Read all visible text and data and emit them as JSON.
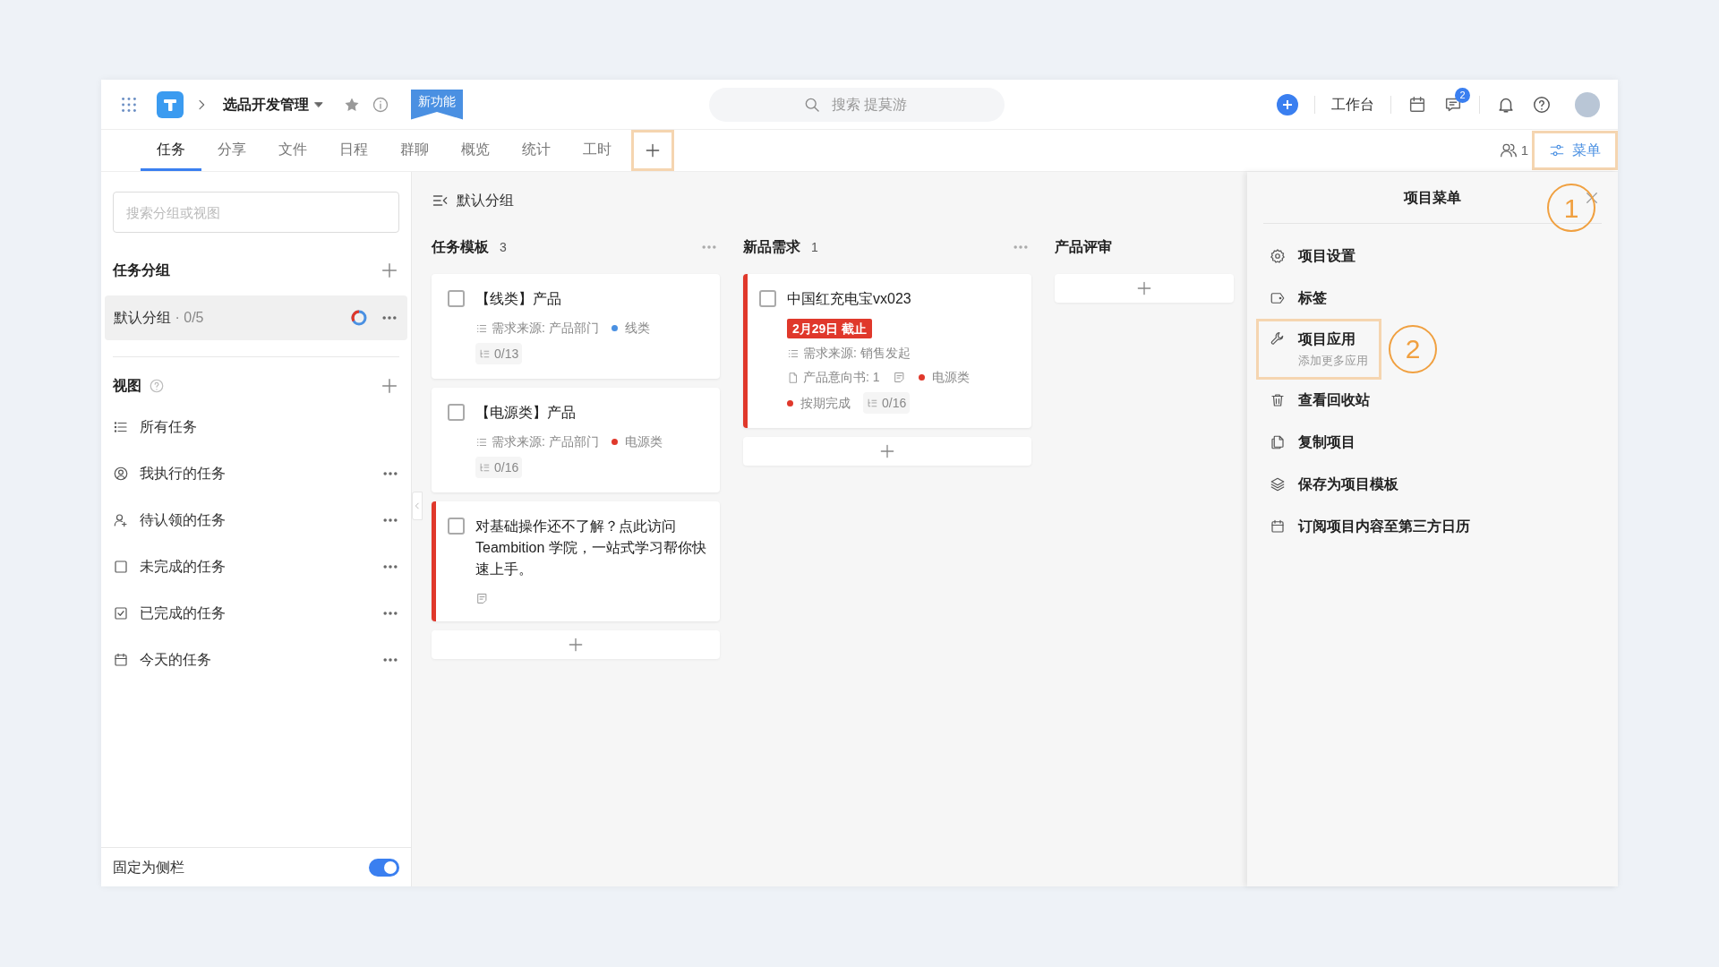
{
  "header": {
    "project": "选品开发管理",
    "new_feature_badge": "新功能",
    "search_placeholder": "搜索 提莫游",
    "workbench": "工作台",
    "message_count": "2"
  },
  "tabs": [
    {
      "label": "任务",
      "selected": true
    },
    {
      "label": "分享",
      "selected": false
    },
    {
      "label": "文件",
      "selected": false
    },
    {
      "label": "日程",
      "selected": false
    },
    {
      "label": "群聊",
      "selected": false
    },
    {
      "label": "概览",
      "selected": false
    },
    {
      "label": "统计",
      "selected": false
    },
    {
      "label": "工时",
      "selected": false
    }
  ],
  "add_tab": {
    "highlighted": true
  },
  "members_count": "1",
  "menu_button": {
    "label": "菜单",
    "highlighted": true
  },
  "sidebar": {
    "search_placeholder": "搜索分组或视图",
    "groups_title": "任务分组",
    "groups": [
      {
        "name": "默认分组",
        "count": "· 0/5",
        "selected": true
      }
    ],
    "views_title": "视图",
    "views": [
      {
        "kind": "list",
        "label": "所有任务",
        "has_more": false
      },
      {
        "kind": "user",
        "label": "我执行的任务",
        "has_more": true
      },
      {
        "kind": "user-plus",
        "label": "待认领的任务",
        "has_more": true
      },
      {
        "kind": "square",
        "label": "未完成的任务",
        "has_more": true
      },
      {
        "kind": "check-square",
        "label": "已完成的任务",
        "has_more": true
      },
      {
        "kind": "calendar",
        "label": "今天的任务",
        "has_more": true
      }
    ],
    "pin_label": "固定为侧栏",
    "pin_on": true
  },
  "board": {
    "group_title": "默认分组",
    "columns": [
      {
        "title": "任务模板",
        "count": "3",
        "has_more": true,
        "cards": [
          {
            "title": "【线类】产品",
            "checked": false,
            "priority_mark": false,
            "rows": [
              [
                {
                  "kind": "source",
                  "text": "需求来源: 产品部门"
                },
                {
                  "kind": "tag",
                  "text": "线类",
                  "color": "#4a90e2"
                }
              ],
              [
                {
                  "kind": "subtasks",
                  "text": "0/13"
                }
              ]
            ]
          },
          {
            "title": "【电源类】产品",
            "checked": false,
            "priority_mark": false,
            "rows": [
              [
                {
                  "kind": "source",
                  "text": "需求来源: 产品部门"
                },
                {
                  "kind": "tag",
                  "text": "电源类",
                  "color": "#e0382b"
                }
              ],
              [
                {
                  "kind": "subtasks",
                  "text": "0/16"
                }
              ]
            ]
          },
          {
            "title": "对基础操作还不了解？点此访问 Teambition 学院，一站式学习帮你快速上手。",
            "checked": false,
            "priority_mark": true,
            "rows": [
              [
                {
                  "kind": "note"
                }
              ]
            ]
          }
        ]
      },
      {
        "title": "新品需求",
        "count": "1",
        "has_more": true,
        "cards": [
          {
            "title": "中国红充电宝vx023",
            "checked": false,
            "priority_mark": true,
            "deadline": "2月29日 截止",
            "rows": [
              [
                {
                  "kind": "source",
                  "text": "需求来源: 销售发起"
                }
              ],
              [
                {
                  "kind": "doc",
                  "text": "产品意向书: 1"
                },
                {
                  "kind": "note"
                },
                {
                  "kind": "tag",
                  "text": "电源类",
                  "color": "#e0382b"
                }
              ],
              [
                {
                  "kind": "tag",
                  "text": "按期完成",
                  "color": "#e0382b"
                },
                {
                  "kind": "subtasks",
                  "text": "0/16"
                }
              ]
            ]
          }
        ]
      },
      {
        "title": "产品评审",
        "has_more": false
      }
    ]
  },
  "menu_panel": {
    "title": "项目菜单",
    "callout": "1",
    "items": [
      {
        "kind": "gear",
        "label": "项目设置",
        "highlighted": false
      },
      {
        "kind": "tag",
        "label": "标签",
        "highlighted": false
      },
      {
        "kind": "wrench",
        "label": "项目应用",
        "subtitle": "添加更多应用",
        "highlighted": true,
        "callout": "2"
      },
      {
        "kind": "trash",
        "label": "查看回收站",
        "highlighted": false
      },
      {
        "kind": "copy",
        "label": "复制项目",
        "highlighted": false
      },
      {
        "kind": "layers",
        "label": "保存为项目模板",
        "highlighted": false
      },
      {
        "kind": "calendar",
        "label": "订阅项目内容至第三方日历",
        "highlighted": false
      }
    ]
  }
}
